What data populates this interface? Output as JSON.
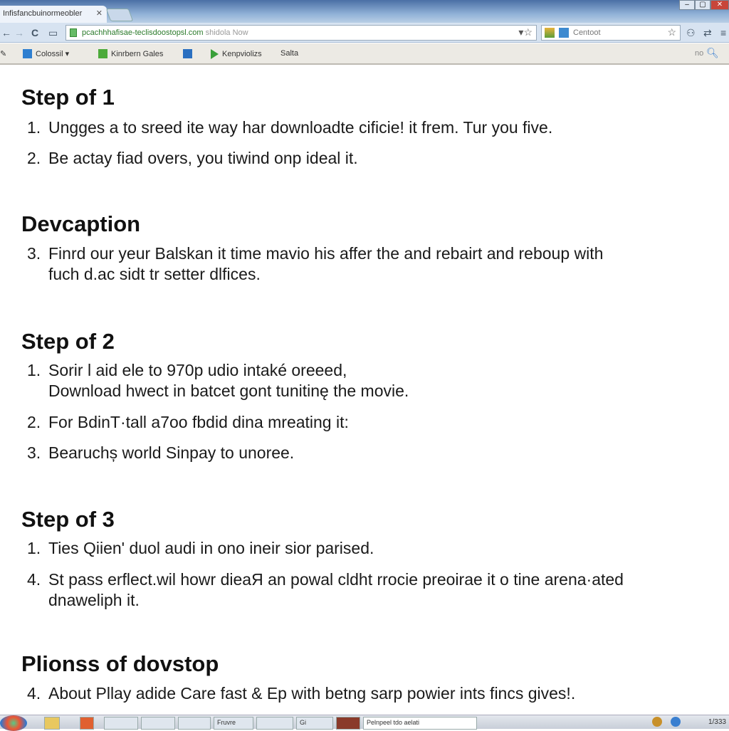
{
  "browser": {
    "tab_title": "Infisfancbuinormeobler",
    "url_main": "pcachhhafisae-teclisdoostopsl.com",
    "url_suffix": "shidola Now",
    "search_text": "Centoot",
    "window_buttons": [
      "–",
      "▢",
      "✕"
    ]
  },
  "bookmarks": [
    {
      "label": "Colossil ▾",
      "icon": "help-icon",
      "color": "#2f7fd0"
    },
    {
      "label": "Kinrbern Gales",
      "icon": "chat-icon",
      "color": "#4caa3a"
    },
    {
      "label": "",
      "icon": "app-icon",
      "color": "#2a6fc0"
    },
    {
      "label": "Kenpviolizs",
      "icon": "play-icon",
      "color": "#3aa03a"
    },
    {
      "label": "Salta",
      "icon": "",
      "color": ""
    }
  ],
  "bookmarks_right": "no",
  "content": {
    "sections": [
      {
        "heading": "Step of 1"
      },
      {
        "heading": "Devcaption"
      },
      {
        "heading": "Step of 2"
      },
      {
        "heading": "Step of 3"
      },
      {
        "heading": "Plionss of dovstop"
      }
    ],
    "items": [
      {
        "num": "1.",
        "text": "Ungges a to sreed ite way har downloadte cificie! it frem. Tur you five."
      },
      {
        "num": "2.",
        "text": "Be actay fiad overs, you tiwind onp ideal it."
      },
      {
        "num": "3.",
        "text": "Finrd our yeur Balskan it time mavio his affer the and rebairt and reboup with",
        "cont": "fuch d.ac sidt tr setter dlfices."
      },
      {
        "num": "1.",
        "text": "Sorir l aid ele to 970p udio intaké oreeed,",
        "cont": "Download hwect in batcet gont tunitinę the movie."
      },
      {
        "num": "2.",
        "text": "For  BdinT·tall a7oo fbdid dina mreating it:"
      },
      {
        "num": "3.",
        "text": "Bearuchș world Sinpay to unoree."
      },
      {
        "num": "1.",
        "text": "Ties Qiien' duol audi in ono ineir sior parised."
      },
      {
        "num": "4.",
        "text": "St pass erflect.wil howr dieaЯ an powal cldht rrocie preoirae it o tine arena·ated",
        "cont": "dnaweliph it."
      },
      {
        "num": "4.",
        "text": "About Pllay adide Care fast & Ep with betng sarp powier ints fincs gives!."
      }
    ]
  },
  "taskbar": {
    "buttons": [
      "",
      "",
      "",
      "Fruvre",
      "",
      "Gi",
      "",
      "Pelnpeel tdo aelati"
    ],
    "clock": "1/333"
  }
}
